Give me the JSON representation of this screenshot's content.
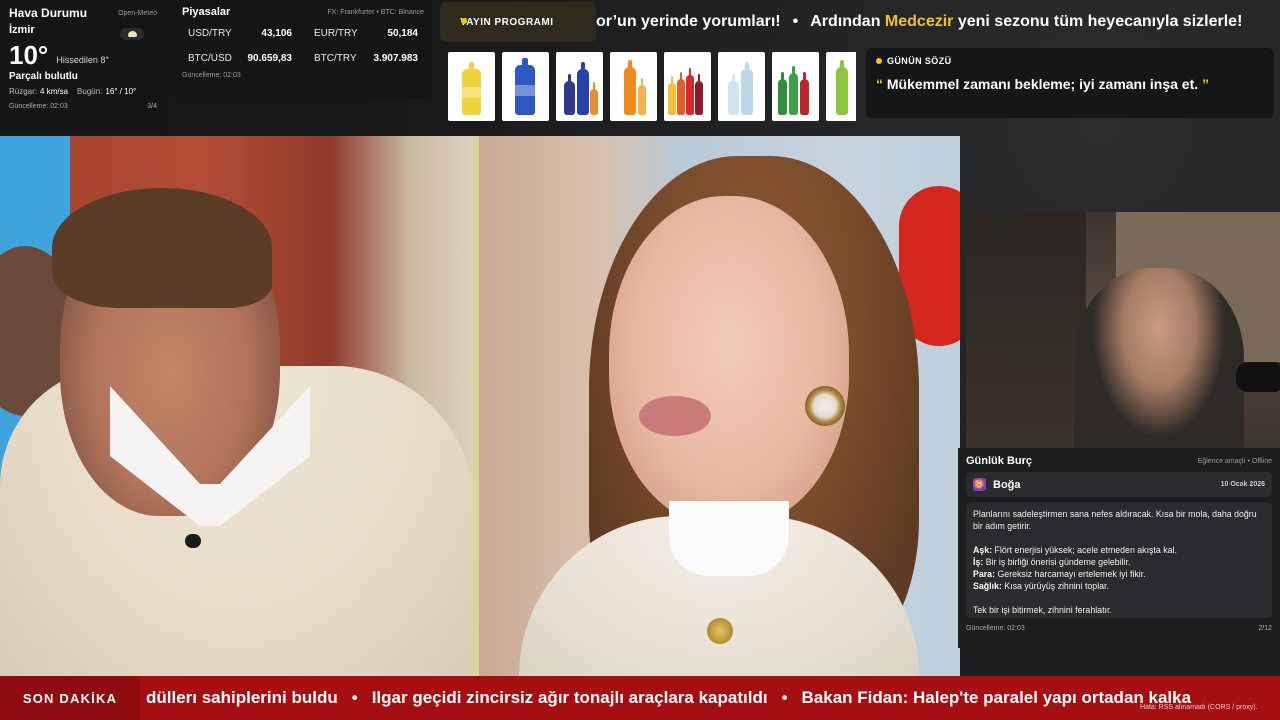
{
  "weather": {
    "title": "Hava Durumu",
    "source": "Open-Meteo",
    "city": "İzmir",
    "temperature": "10°",
    "feels_like": "Hissedilen 8°",
    "condition": "Parçalı bulutlu",
    "wind_label": "Rüzgar:",
    "wind_value": "4 km/sa",
    "today_label": "Bugün:",
    "today_value": "16° / 10°",
    "updated": "Güncelleme: 02:03",
    "page": "3/4",
    "icon": "partly-cloudy-icon"
  },
  "markets": {
    "title": "Piyasalar",
    "source": "FX: Frankfurter • BTC: Binance",
    "rows": [
      {
        "name": "USD/TRY",
        "value": "43,106"
      },
      {
        "name": "EUR/TRY",
        "value": "50,184"
      },
      {
        "name": "BTC/USD",
        "value": "90.659,83"
      },
      {
        "name": "BTC/TRY",
        "value": "3.907.983"
      }
    ],
    "updated": "Güncelleme: 02:03"
  },
  "schedule": {
    "label": "YAYIN PROGRAMI"
  },
  "ticker": {
    "part1": "or’un yerinde yorumları!",
    "sep": "•",
    "part2a": "Ardından ",
    "part2_highlight": "Medcezir",
    "part2b": " yeni sezonu tüm heyecanıyla sizlerle!",
    "highlight_color": "#f0c419"
  },
  "quote": {
    "title": "GÜNÜN SÖZÜ",
    "open_mark": "“",
    "text": " Mükemmel zamanı bekleme; iyi zamanı inşa et. ",
    "close_mark": "”"
  },
  "horoscope": {
    "title": "Günlük Burç",
    "subtitle": "Eğlence amaçlı • Offline",
    "sign_symbol": "♉",
    "sign": "Boğa",
    "date": "10 Ocak 2026",
    "intro": "Planlarını sadeleştirmen sana nefes aldıracak. Kısa bir mola, daha doğru bir adım getirir.",
    "love_label": "Aşk:",
    "love": " Flört enerjisi yüksek; acele etmeden akışta kal.",
    "work_label": "İş:",
    "work": " Bir iş birliği önerisi gündeme gelebilir.",
    "money_label": "Para:",
    "money": " Gereksiz harcamayı ertelemek iyi fikir.",
    "health_label": "Sağlık:",
    "health": " Kısa yürüyüş zihnini toplar.",
    "tip": "Tek bir işi bitirmek, zihnini ferahlatır.",
    "updated": "Güncelleme: 02:03",
    "page": "2/12"
  },
  "news": {
    "label": "SON DAKİKA",
    "items": [
      "düllerı sahiplerini buldu",
      "Ilgar geçidi zincirsiz ağır tonajlı araçlara kapatıldı",
      "Bakan Fidan: Halep'te paralel yapı ortadan kalka"
    ],
    "sep": "•",
    "error": "Hata: RSS alınamadı (CORS / proxy)."
  },
  "colors": {
    "accent_yellow": "#f2c511",
    "news_red": "#a50f12"
  }
}
